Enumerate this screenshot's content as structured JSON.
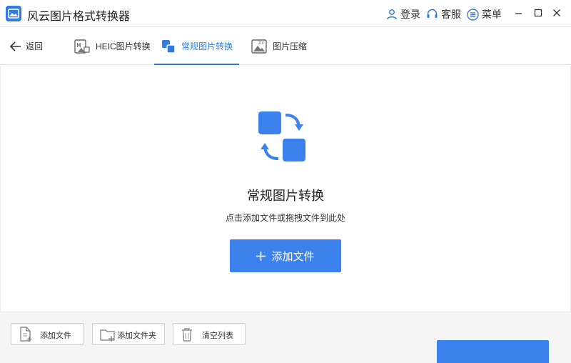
{
  "app": {
    "title": "风云图片格式转换器"
  },
  "titlebar": {
    "login_label": "登录",
    "service_label": "客服",
    "menu_label": "菜单"
  },
  "nav": {
    "back_label": "返回",
    "tabs": [
      {
        "label": "HEIC图片转换",
        "icon": "heic-icon",
        "active": false
      },
      {
        "label": "常规图片转换",
        "icon": "convert-icon",
        "active": true
      },
      {
        "label": "图片压缩",
        "icon": "zip-image-icon",
        "active": false
      }
    ]
  },
  "main": {
    "title": "常规图片转换",
    "hint": "点击添加文件或拖拽文件到此处",
    "add_button_label": "添加文件"
  },
  "toolbar": {
    "add_file_label": "添加文件",
    "add_folder_label": "添加文件夹",
    "clear_list_label": "清空列表"
  },
  "colors": {
    "accent": "#3b82ed",
    "icon_blue": "#2f7de1",
    "bottom_bg": "#f5f5f5"
  }
}
